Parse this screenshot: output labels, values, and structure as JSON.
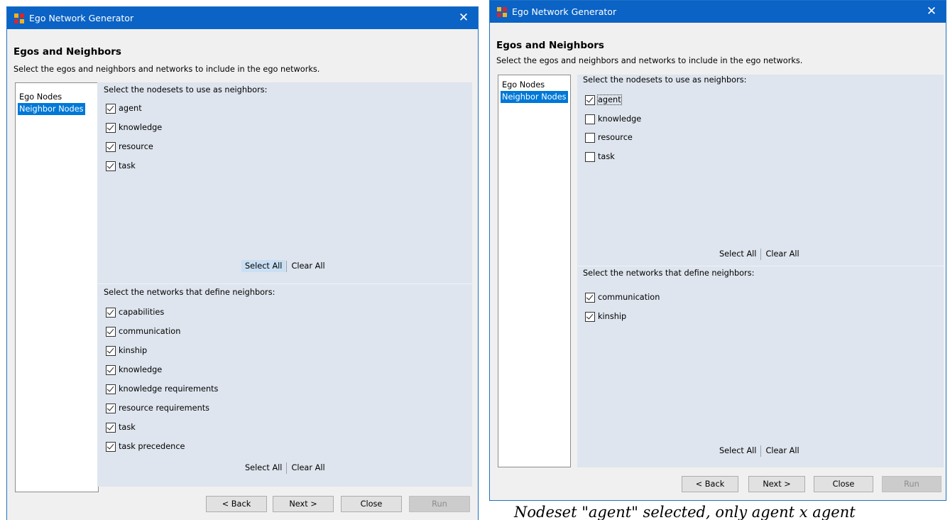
{
  "left": {
    "title": "Ego Network Generator",
    "heading": "Egos and Neighbors",
    "subheading": "Select the egos and neighbors and networks to include in the ego networks.",
    "nav": [
      "Ego Nodes",
      "Neighbor Nodes"
    ],
    "selected_nav": "Neighbor Nodes",
    "nodesets_label": "Select the nodesets to use as neighbors:",
    "nodesets": [
      {
        "label": "agent",
        "checked": true
      },
      {
        "label": "knowledge",
        "checked": true
      },
      {
        "label": "resource",
        "checked": true
      },
      {
        "label": "task",
        "checked": true
      }
    ],
    "networks_label": "Select the networks that define neighbors:",
    "networks": [
      {
        "label": "capabilities",
        "checked": true
      },
      {
        "label": "communication",
        "checked": true
      },
      {
        "label": "kinship",
        "checked": true
      },
      {
        "label": "knowledge",
        "checked": true
      },
      {
        "label": "knowledge requirements",
        "checked": true
      },
      {
        "label": "resource requirements",
        "checked": true
      },
      {
        "label": "task",
        "checked": true
      },
      {
        "label": "task precedence",
        "checked": true
      }
    ],
    "select_all": "Select All",
    "clear_all": "Clear All",
    "buttons": {
      "back": "< Back",
      "next": "Next >",
      "close": "Close",
      "run": "Run"
    }
  },
  "right": {
    "title": "Ego Network Generator",
    "heading": "Egos and Neighbors",
    "subheading": "Select the egos and neighbors and networks to include in the ego networks.",
    "nav": [
      "Ego Nodes",
      "Neighbor Nodes"
    ],
    "selected_nav": "Neighbor Nodes",
    "nodesets_label": "Select the nodesets to use as neighbors:",
    "nodesets": [
      {
        "label": "agent",
        "checked": true
      },
      {
        "label": "knowledge",
        "checked": false
      },
      {
        "label": "resource",
        "checked": false
      },
      {
        "label": "task",
        "checked": false
      }
    ],
    "networks_label": "Select the networks that define neighbors:",
    "networks": [
      {
        "label": "communication",
        "checked": true
      },
      {
        "label": "kinship",
        "checked": true
      }
    ],
    "select_all": "Select All",
    "clear_all": "Clear All",
    "buttons": {
      "back": "< Back",
      "next": "Next >",
      "close": "Close",
      "run": "Run"
    }
  },
  "caption": "Nodeset \"agent\" selected, only agent x agent"
}
